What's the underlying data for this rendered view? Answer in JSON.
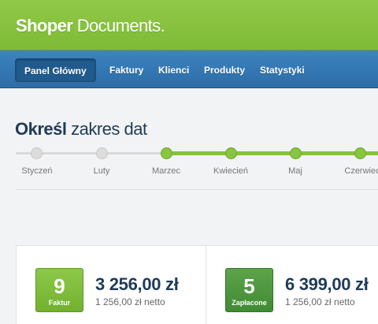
{
  "header": {
    "logo_bold": "Shoper",
    "logo_light": " Documents."
  },
  "nav": {
    "items": [
      {
        "label": "Panel Główny",
        "active": true
      },
      {
        "label": "Faktury"
      },
      {
        "label": "Klienci"
      },
      {
        "label": "Produkty"
      },
      {
        "label": "Statystyki"
      }
    ]
  },
  "date_range": {
    "title_bold": "Określ",
    "title_light": " zakres dat",
    "months": [
      "Styczeń",
      "Luty",
      "Marzec",
      "Kwiecień",
      "Maj",
      "Czerwiec"
    ],
    "selected_from": "Marzec"
  },
  "cards": [
    {
      "count": "9",
      "count_label": "Faktur",
      "amount": "3 256,00 zł",
      "net": "1 256,00 zł netto"
    },
    {
      "count": "5",
      "count_label": "Zapłacone",
      "amount": "6 399,00 zł",
      "net": "1 256,00 zł netto"
    }
  ],
  "colors": {
    "header_green": "#86c23e",
    "nav_blue": "#3478b4",
    "title_navy": "#1f3b58"
  }
}
